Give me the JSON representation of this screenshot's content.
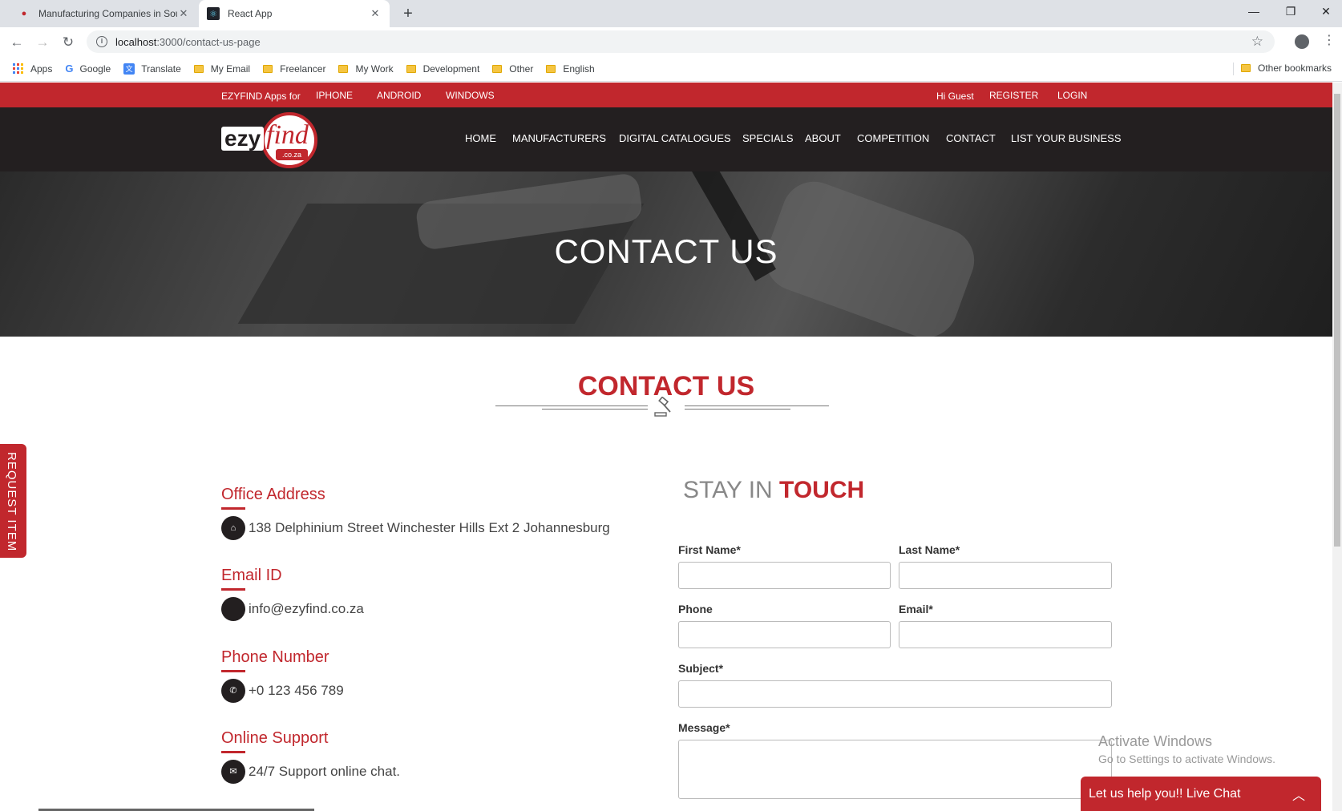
{
  "browser": {
    "tabs": [
      {
        "title": "Manufacturing Companies in Sou",
        "active": false
      },
      {
        "title": "React App",
        "active": true
      }
    ],
    "url_host": "localhost",
    "url_path": ":3000/contact-us-page",
    "bookmarks": [
      "Apps",
      "Google",
      "Translate",
      "My Email",
      "Freelancer",
      "My Work",
      "Development",
      "Other",
      "English"
    ],
    "other_bookmarks": "Other bookmarks"
  },
  "topbar": {
    "apps_for": "EZYFIND Apps for",
    "iphone": "IPHONE",
    "android": "ANDROID",
    "windows": "WINDOWS",
    "greeting": "Hi Guest",
    "register": "REGISTER",
    "login": "LOGIN"
  },
  "logo": {
    "ezy": "ezy",
    "find": "find",
    "coza": ".co.za"
  },
  "nav": {
    "items": [
      "HOME",
      "MANUFACTURERS",
      "DIGITAL CATALOGUES",
      "SPECIALS",
      "ABOUT",
      "COMPETITION",
      "CONTACT",
      "LIST YOUR BUSINESS"
    ]
  },
  "hero": {
    "title": "CONTACT US"
  },
  "section": {
    "title": "CONTACT US"
  },
  "request_tab": "REQUEST ITEM",
  "contact_info": [
    {
      "heading": "Office Address",
      "text": "138 Delphinium Street Winchester Hills Ext 2 Johannesburg",
      "icon": "location-icon"
    },
    {
      "heading": "Email ID",
      "text": "info@ezyfind.co.za",
      "icon": "email-icon"
    },
    {
      "heading": "Phone Number",
      "text": "+0 123 456 789",
      "icon": "phone-icon"
    },
    {
      "heading": "Online Support",
      "text": "24/7 Support online chat.",
      "icon": "chat-icon"
    }
  ],
  "form": {
    "heading_light": "STAY IN",
    "heading_bold": "TOUCH",
    "first_name": "First Name*",
    "last_name": "Last Name*",
    "phone": "Phone",
    "email": "Email*",
    "subject": "Subject*",
    "message": "Message*"
  },
  "watermark": {
    "title": "Activate Windows",
    "subtitle": "Go to Settings to activate Windows."
  },
  "livechat": {
    "label": "Let us help you!! Live Chat"
  },
  "colors": {
    "brand_red": "#c1272d",
    "nav_dark": "#231f20"
  }
}
